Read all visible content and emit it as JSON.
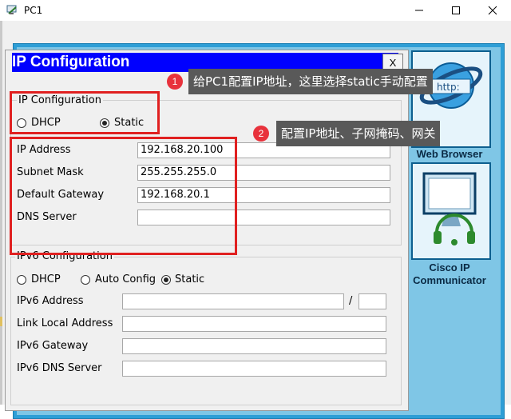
{
  "window": {
    "title": "PC1"
  },
  "desktop": {
    "web_browser_label": "Web Browser",
    "communicator_label_1": "Cisco IP",
    "communicator_label_2": "Communicator",
    "browser_icon_text": "http:"
  },
  "dialog": {
    "title": "IP Configuration",
    "close_label": "X",
    "ipv4": {
      "legend": "IP Configuration",
      "dhcp_label": "DHCP",
      "static_label": "Static",
      "selected": "Static",
      "ip_address_label": "IP Address",
      "ip_address_value": "192.168.20.100",
      "subnet_mask_label": "Subnet Mask",
      "subnet_mask_value": "255.255.255.0",
      "gateway_label": "Default Gateway",
      "gateway_value": "192.168.20.1",
      "dns_label": "DNS Server",
      "dns_value": ""
    },
    "ipv6": {
      "legend": "IPv6 Configuration",
      "dhcp_label": "DHCP",
      "auto_label": "Auto Config",
      "static_label": "Static",
      "selected": "Static",
      "address_label": "IPv6 Address",
      "address_value": "",
      "prefix_sep": "/",
      "prefix_value": "",
      "link_local_label": "Link Local Address",
      "link_local_value": "",
      "gateway_label": "IPv6 Gateway",
      "gateway_value": "",
      "dns_label": "IPv6 DNS Server",
      "dns_value": ""
    }
  },
  "annotations": [
    {
      "number": "1",
      "text": "给PC1配置IP地址，这里选择static手动配置"
    },
    {
      "number": "2",
      "text": "配置IP地址、子网掩码、网关"
    }
  ],
  "colors": {
    "dialog_title_bg": "#0000ff",
    "highlight_red": "#e02020",
    "callout_bg": "#595959",
    "badge_red": "#e8323c",
    "desktop_blue": "#2e9ed6"
  }
}
